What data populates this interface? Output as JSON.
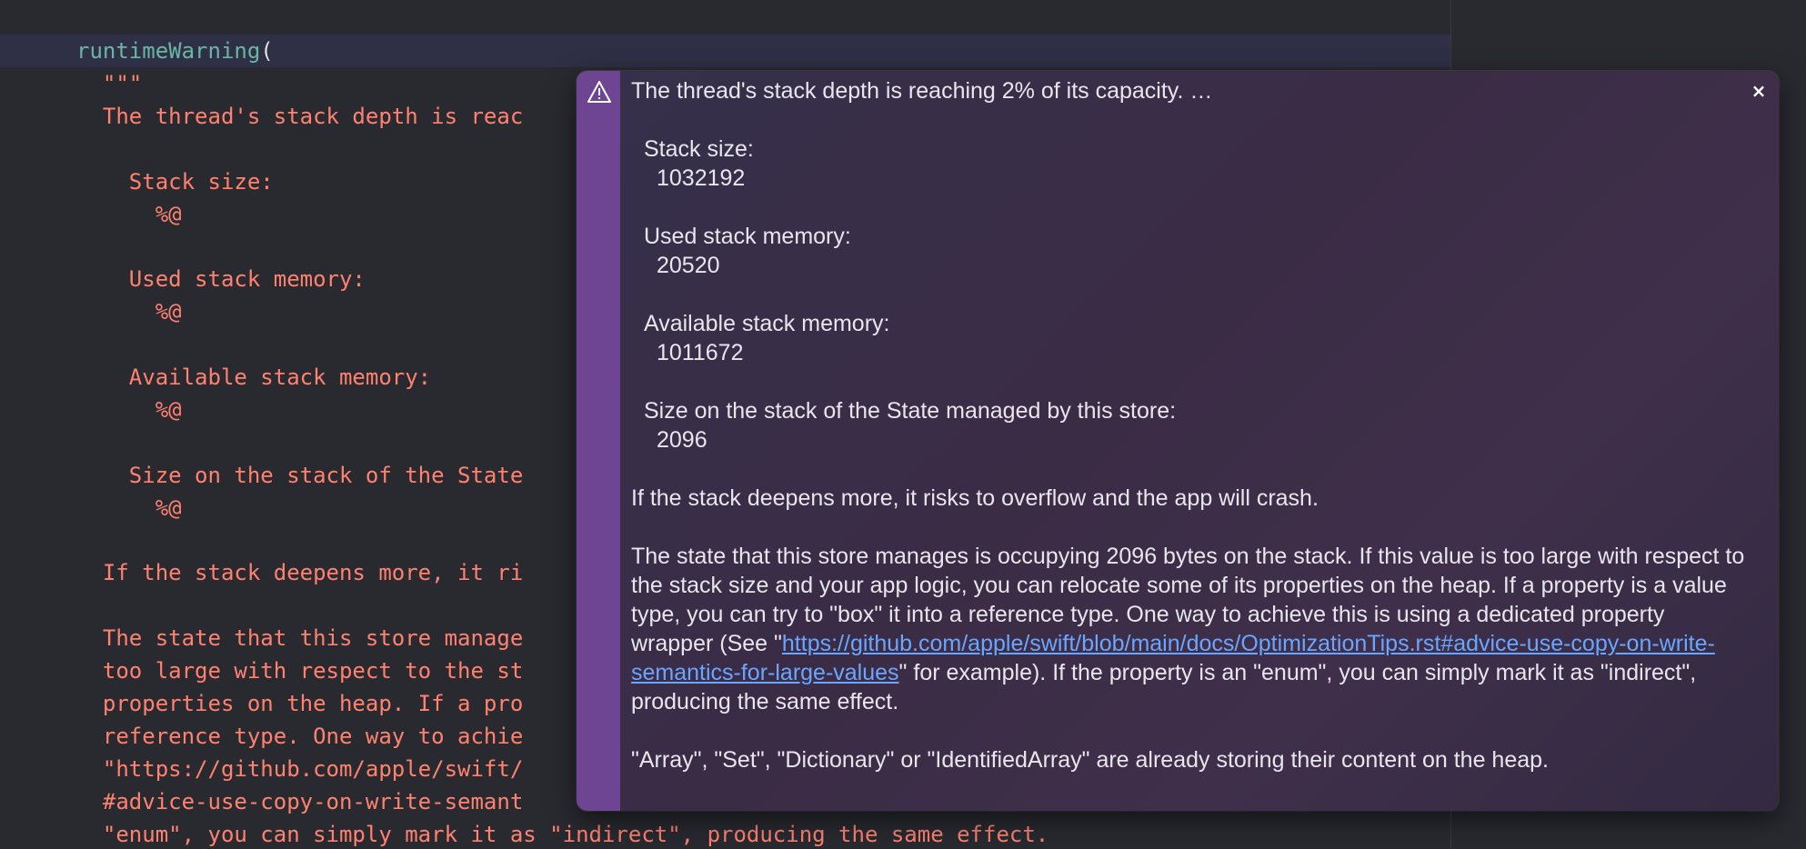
{
  "editor": {
    "lines": [
      {
        "fn": "runtimeWarning",
        "punct": "("
      },
      {
        "text": "  \"\"\""
      },
      {
        "text": "  The thread's stack depth is reac"
      },
      {
        "text": ""
      },
      {
        "text": "    Stack size:"
      },
      {
        "text": "      %@"
      },
      {
        "text": ""
      },
      {
        "text": "    Used stack memory:"
      },
      {
        "text": "      %@"
      },
      {
        "text": ""
      },
      {
        "text": "    Available stack memory:"
      },
      {
        "text": "      %@"
      },
      {
        "text": ""
      },
      {
        "text": "    Size on the stack of the State"
      },
      {
        "text": "      %@"
      },
      {
        "text": ""
      },
      {
        "text": "  If the stack deepens more, it ri"
      },
      {
        "text": ""
      },
      {
        "text": "  The state that this store manage"
      },
      {
        "text": "  too large with respect to the st"
      },
      {
        "text": "  properties on the heap. If a pro"
      },
      {
        "text": "  reference type. One way to achie"
      },
      {
        "text": "  \"https://github.com/apple/swift/"
      },
      {
        "text": "  #advice-use-copy-on-write-semant"
      },
      {
        "text": "  \"enum\", you can simply mark it as \"indirect\", producing the same effect."
      }
    ]
  },
  "popover": {
    "icon": "warning-triangle-icon",
    "close_label": "×",
    "title": "The thread's stack depth is reaching 2% of its capacity. …",
    "stack_size_label": "Stack size:",
    "stack_size_value": "1032192",
    "used_label": "Used stack memory:",
    "used_value": "20520",
    "available_label": "Available stack memory:",
    "available_value": "1011672",
    "state_size_label": "Size on the stack of the State managed by this store:",
    "state_size_value": "2096",
    "overflow_text": "If the stack deepens more, it risks to overflow and the app will crash.",
    "para_before_link": "The state that this store manages is occupying 2096 bytes on the stack. If this value is too large with respect to the stack size and your app logic, you can relocate some of its properties on the heap. If a property is a value type, you can try to \"box\" it into a reference type. One way to achieve this is using a dedicated property wrapper (See \"",
    "link_text": "https://github.com/apple/swift/blob/main/docs/OptimizationTips.rst#advice-use-copy-on-write-semantics-for-large-values",
    "para_after_link": "\" for example). If the property is an \"enum\", you can simply mark it as \"indirect\", producing the same effect.",
    "last_text": "\"Array\", \"Set\", \"Dictionary\" or \"IdentifiedArray\" are already storing their content on the heap."
  },
  "colors": {
    "editor_bg": "#292a30",
    "string_color": "#ff8170",
    "function_color": "#67b7a4",
    "stripe_color": "#6e4593",
    "link_color": "#6aa6ff"
  }
}
